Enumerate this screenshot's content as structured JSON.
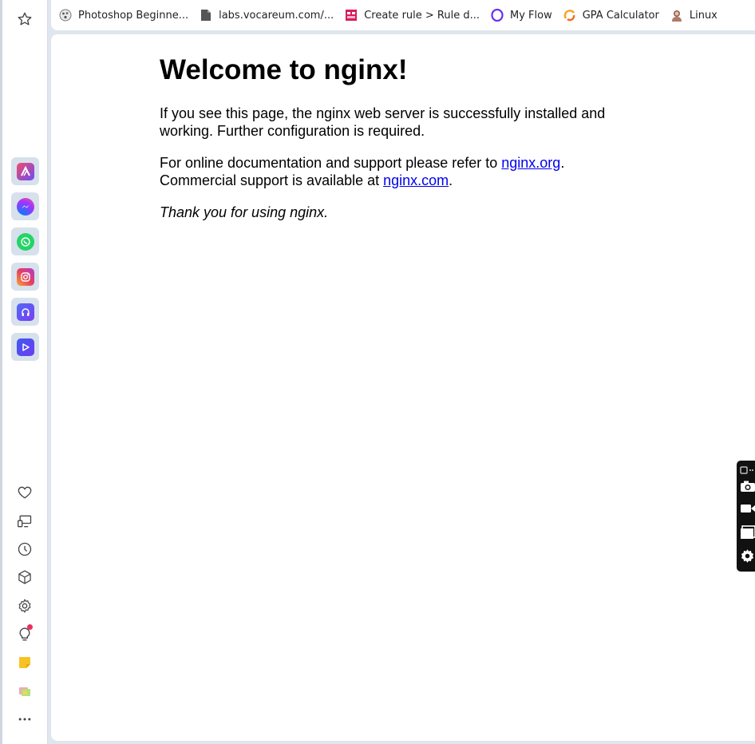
{
  "bookmarks": [
    {
      "label": "Photoshop Beginne...",
      "icon": "photoshop-favicon-icon"
    },
    {
      "label": "labs.vocareum.com/...",
      "icon": "document-icon"
    },
    {
      "label": "Create rule > Rule d...",
      "icon": "rule-favicon-icon"
    },
    {
      "label": "My Flow",
      "icon": "opera-icon"
    },
    {
      "label": "GPA Calculator",
      "icon": "gpa-favicon-icon"
    },
    {
      "label": "Linux",
      "icon": "linux-avatar-icon"
    }
  ],
  "sidebar": {
    "top_icon": "star-icon",
    "apps": [
      "aria-app-icon",
      "messenger-app-icon",
      "whatsapp-app-icon",
      "instagram-app-icon",
      "music-app-icon",
      "player-app-icon"
    ],
    "bottom_icons": [
      "heart-icon",
      "cast-icon",
      "history-icon",
      "cube-icon",
      "settings-icon",
      "lightbulb-icon",
      "notes-icon",
      "gallery-icon",
      "more-icon"
    ]
  },
  "page": {
    "heading": "Welcome to nginx!",
    "para1": "If you see this page, the nginx web server is successfully installed and working. Further configuration is required.",
    "para2_pre": "For online documentation and support please refer to ",
    "link_org": "nginx.org",
    "para2_mid": ". Commercial support is available at ",
    "link_com": "nginx.com",
    "para2_post": ".",
    "thanks": "Thank you for using nginx."
  },
  "colors": {
    "link": "#0000ee",
    "notification": "#e8315a"
  }
}
